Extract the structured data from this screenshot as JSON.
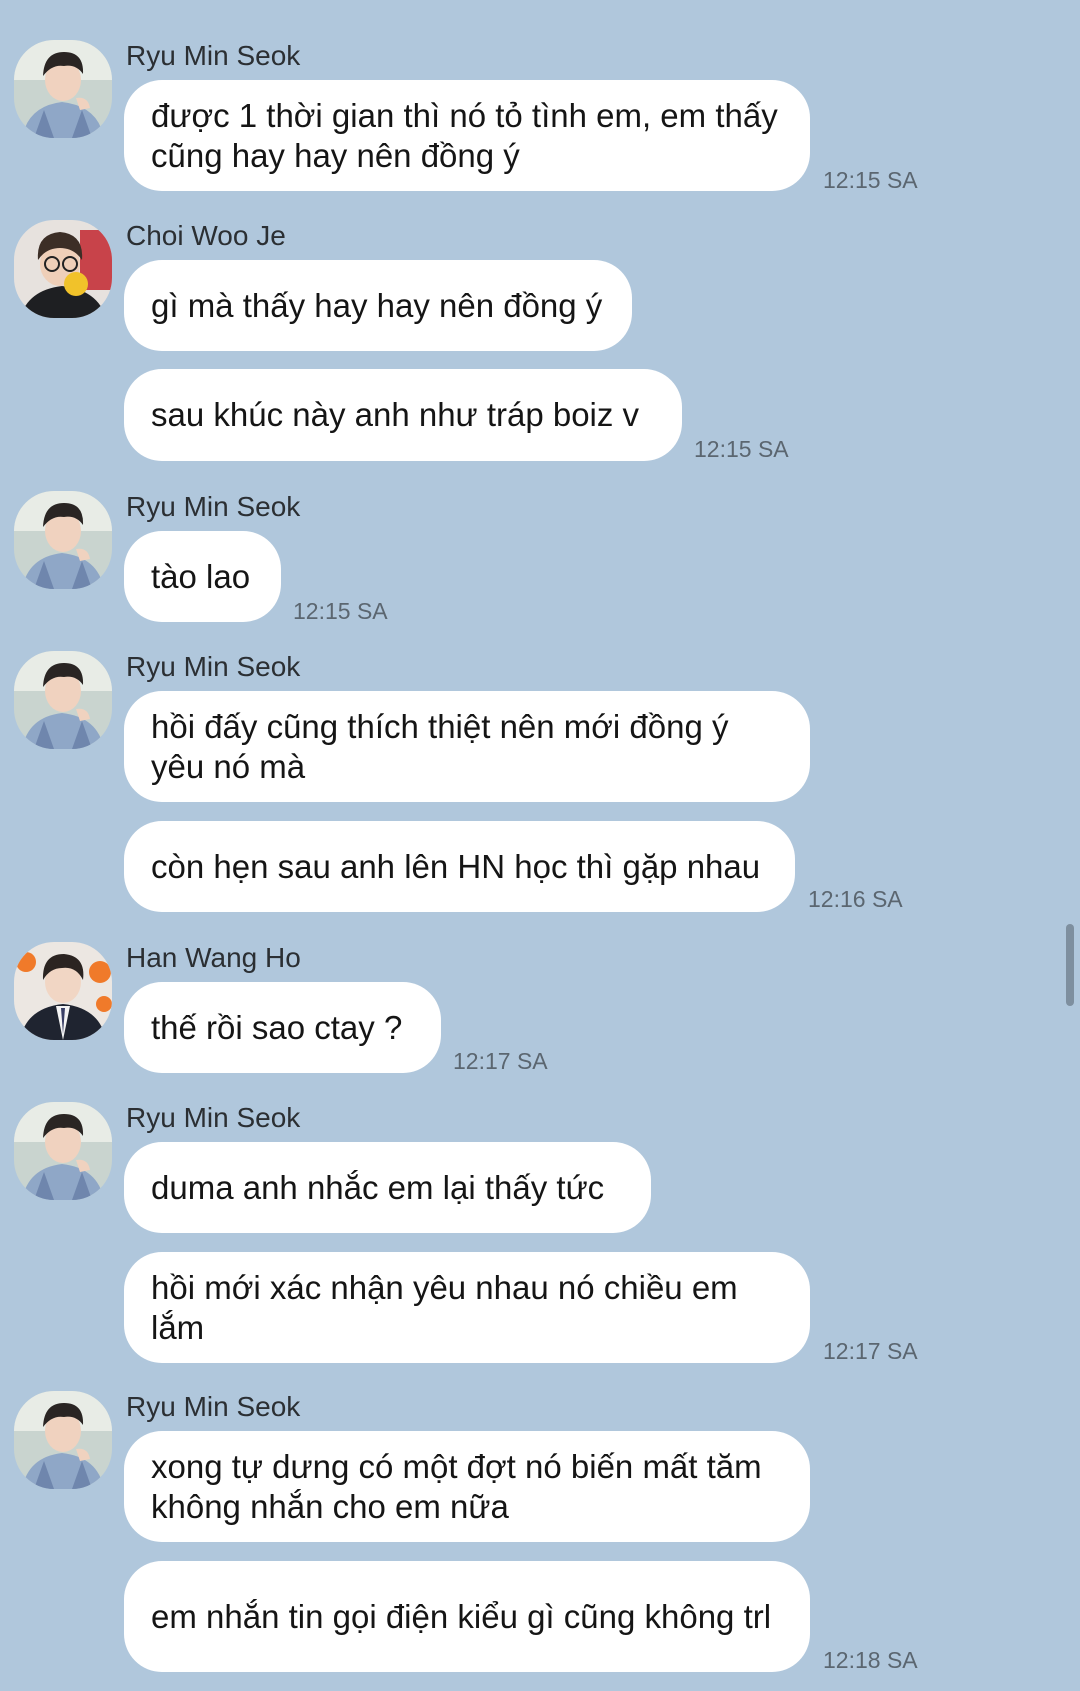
{
  "conversation": {
    "groups": [
      {
        "sender": "Ryu Min Seok",
        "avatar_icon": "ryu-min-seok-avatar",
        "messages": [
          {
            "text": "được 1 thời gian thì nó tỏ tình em, em thấy cũng hay hay nên đồng ý",
            "time": "12:15 SA"
          }
        ]
      },
      {
        "sender": "Choi Woo Je",
        "avatar_icon": "choi-woo-je-avatar",
        "messages": [
          {
            "text": "gì mà thấy hay hay nên đồng ý",
            "time": ""
          },
          {
            "text": "sau khúc này anh như tráp boiz v",
            "time": "12:15 SA"
          }
        ]
      },
      {
        "sender": "Ryu Min Seok",
        "avatar_icon": "ryu-min-seok-avatar",
        "messages": [
          {
            "text": "tào lao",
            "time": "12:15 SA"
          }
        ]
      },
      {
        "sender": "Ryu Min Seok",
        "avatar_icon": "ryu-min-seok-avatar",
        "messages": [
          {
            "text": "hồi đấy cũng thích thiệt nên mới đồng ý yêu nó mà",
            "time": ""
          },
          {
            "text": "còn hẹn sau anh lên HN học thì gặp nhau",
            "time": "12:16 SA"
          }
        ]
      },
      {
        "sender": "Han Wang Ho",
        "avatar_icon": "han-wang-ho-avatar",
        "messages": [
          {
            "text": "thế rồi sao ctay ?",
            "time": "12:17 SA"
          }
        ]
      },
      {
        "sender": "Ryu Min Seok",
        "avatar_icon": "ryu-min-seok-avatar",
        "messages": [
          {
            "text": "duma anh nhắc em lại thấy tức",
            "time": ""
          },
          {
            "text": "hồi mới xác nhận yêu nhau nó chiều em lắm",
            "time": "12:17 SA"
          }
        ]
      },
      {
        "sender": "Ryu Min Seok",
        "avatar_icon": "ryu-min-seok-avatar",
        "messages": [
          {
            "text": "xong tự dưng có một đợt nó biến mất tăm không nhắn cho em nữa",
            "time": ""
          },
          {
            "text": "em nhắn tin gọi điện kiểu gì cũng không trl",
            "time": "12:18 SA"
          }
        ]
      }
    ]
  },
  "colors": {
    "background": "#b0c7dc",
    "bubble": "#ffffff",
    "text": "#151515",
    "time": "#5b6670"
  }
}
